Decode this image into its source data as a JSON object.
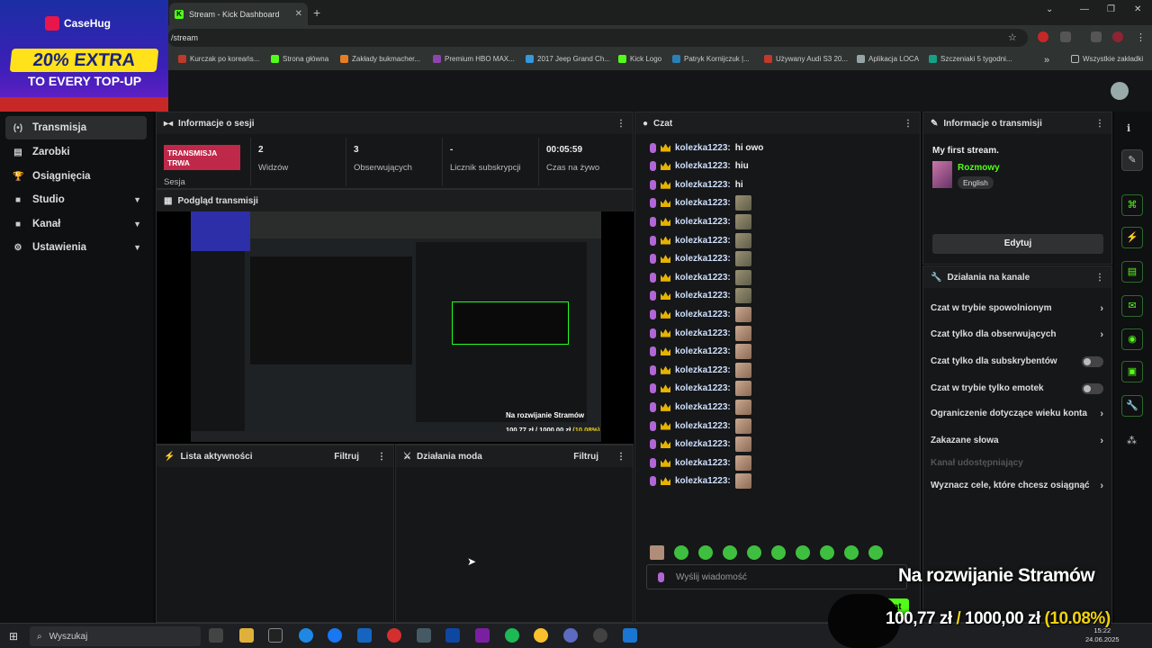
{
  "browser": {
    "tab_title": "Stream - Kick Dashboard",
    "tab_close": "✕",
    "new_tab": "+",
    "url": "/stream",
    "window_controls": [
      "⌄",
      "—",
      "❐",
      "✕"
    ],
    "bookmarks": [
      {
        "label": "Kurczak po koreańs...",
        "color": "#c0392b"
      },
      {
        "label": "Strona główna",
        "color": "#53fc18"
      },
      {
        "label": "Zakłady bukmacher...",
        "color": "#e67e22"
      },
      {
        "label": "Premium HBO MAX...",
        "color": "#8e44ad"
      },
      {
        "label": "2017 Jeep Grand Ch...",
        "color": "#3498db"
      },
      {
        "label": "Kick Logo",
        "color": "#53fc18"
      },
      {
        "label": "Patryk Kornijczuk |...",
        "color": "#2980b9"
      },
      {
        "label": "Używany Audi S3 20...",
        "color": "#c0392b"
      },
      {
        "label": "Aplikacja LOCA",
        "color": "#95a5a6"
      },
      {
        "label": "Szczeniaki 5 tygodni...",
        "color": "#16a085"
      }
    ],
    "bookmarks_more": "»",
    "bookmarks_all": "Wszystkie zakładki"
  },
  "ad": {
    "brand": "CaseHug",
    "headline": "20% EXTRA",
    "subline": "TO EVERY TOP-UP"
  },
  "sidebar": {
    "items": [
      {
        "label": "Transmisja",
        "icon": "(•)",
        "has_chevron": false
      },
      {
        "label": "Zarobki",
        "icon": "▤",
        "has_chevron": false
      },
      {
        "label": "Osiągnięcia",
        "icon": "🏆",
        "has_chevron": false
      },
      {
        "label": "Studio",
        "icon": "■",
        "has_chevron": true
      },
      {
        "label": "Kanał",
        "icon": "■",
        "has_chevron": true
      },
      {
        "label": "Ustawienia",
        "icon": "⚙",
        "has_chevron": true
      }
    ]
  },
  "session": {
    "title": "Informacje o sesji",
    "live_badge": "TRANSMISJA TRWA",
    "live_label": "Sesja",
    "stats": [
      {
        "value": "2",
        "label": "Widzów"
      },
      {
        "value": "3",
        "label": "Obserwujących"
      },
      {
        "value": "-",
        "label": "Licznik subskrypcji"
      },
      {
        "value": "00:05:59",
        "label": "Czas na żywo"
      }
    ]
  },
  "preview": {
    "title": "Podgląd transmisji"
  },
  "activity": {
    "title": "Lista aktywności",
    "filter": "Filtruj"
  },
  "modactions": {
    "title": "Działania moda",
    "filter": "Filtruj"
  },
  "chat": {
    "title": "Czat",
    "messages": [
      {
        "user": "kolezka1223:",
        "text": "hi owo",
        "emote": null
      },
      {
        "user": "kolezka1223:",
        "text": "hiu",
        "emote": null
      },
      {
        "user": "kolezka1223:",
        "text": "hi",
        "emote": null
      },
      {
        "user": "kolezka1223:",
        "text": "",
        "emote": "g"
      },
      {
        "user": "kolezka1223:",
        "text": "",
        "emote": "g"
      },
      {
        "user": "kolezka1223:",
        "text": "",
        "emote": "g"
      },
      {
        "user": "kolezka1223:",
        "text": "",
        "emote": "g"
      },
      {
        "user": "kolezka1223:",
        "text": "",
        "emote": "g"
      },
      {
        "user": "kolezka1223:",
        "text": "",
        "emote": "g"
      },
      {
        "user": "kolezka1223:",
        "text": "",
        "emote": "f"
      },
      {
        "user": "kolezka1223:",
        "text": "",
        "emote": "f"
      },
      {
        "user": "kolezka1223:",
        "text": "",
        "emote": "f"
      },
      {
        "user": "kolezka1223:",
        "text": "",
        "emote": "f"
      },
      {
        "user": "kolezka1223:",
        "text": "",
        "emote": "f"
      },
      {
        "user": "kolezka1223:",
        "text": "",
        "emote": "f"
      },
      {
        "user": "kolezka1223:",
        "text": "",
        "emote": "f"
      },
      {
        "user": "kolezka1223:",
        "text": "",
        "emote": "f"
      },
      {
        "user": "kolezka1223:",
        "text": "",
        "emote": "f"
      },
      {
        "user": "kolezka1223:",
        "text": "",
        "emote": "f"
      }
    ],
    "input_placeholder": "Wyślij wiadomość",
    "send_label": "Czat"
  },
  "stream_info": {
    "title": "Informacje o transmisji",
    "stream_title": "My first stream.",
    "category": "Rozmowy",
    "language": "English",
    "edit_label": "Edytuj"
  },
  "channel_actions": {
    "title": "Działania na kanale",
    "items": [
      {
        "label": "Czat w trybie spowolnionym",
        "control": "chevron"
      },
      {
        "label": "Czat tylko dla obserwujących",
        "control": "chevron"
      },
      {
        "label": "Czat tylko dla subskrybentów",
        "control": "toggle"
      },
      {
        "label": "Czat w trybie tylko emotek",
        "control": "toggle"
      },
      {
        "label": "Ograniczenie dotyczące wieku konta",
        "control": "chevron"
      },
      {
        "label": "Zakazane słowa",
        "control": "chevron"
      },
      {
        "label": "Kanał udostępniający",
        "control": "none"
      },
      {
        "label": "Wyznacz cele, które chcesz osiągnąć",
        "control": "chevron"
      }
    ]
  },
  "overlay": {
    "goal_title": "Na rozwijanie Stramów",
    "current": "100,77 zł",
    "separator": "/",
    "target": "1000,00 zł",
    "percent": "(10.08%)"
  },
  "taskbar": {
    "search_placeholder": "Wyszukaj",
    "time": "15:22",
    "date": "24.06.2025"
  },
  "colors": {
    "accent": "#53fc18",
    "live": "#c0284a",
    "username": "#cfe0ff"
  }
}
